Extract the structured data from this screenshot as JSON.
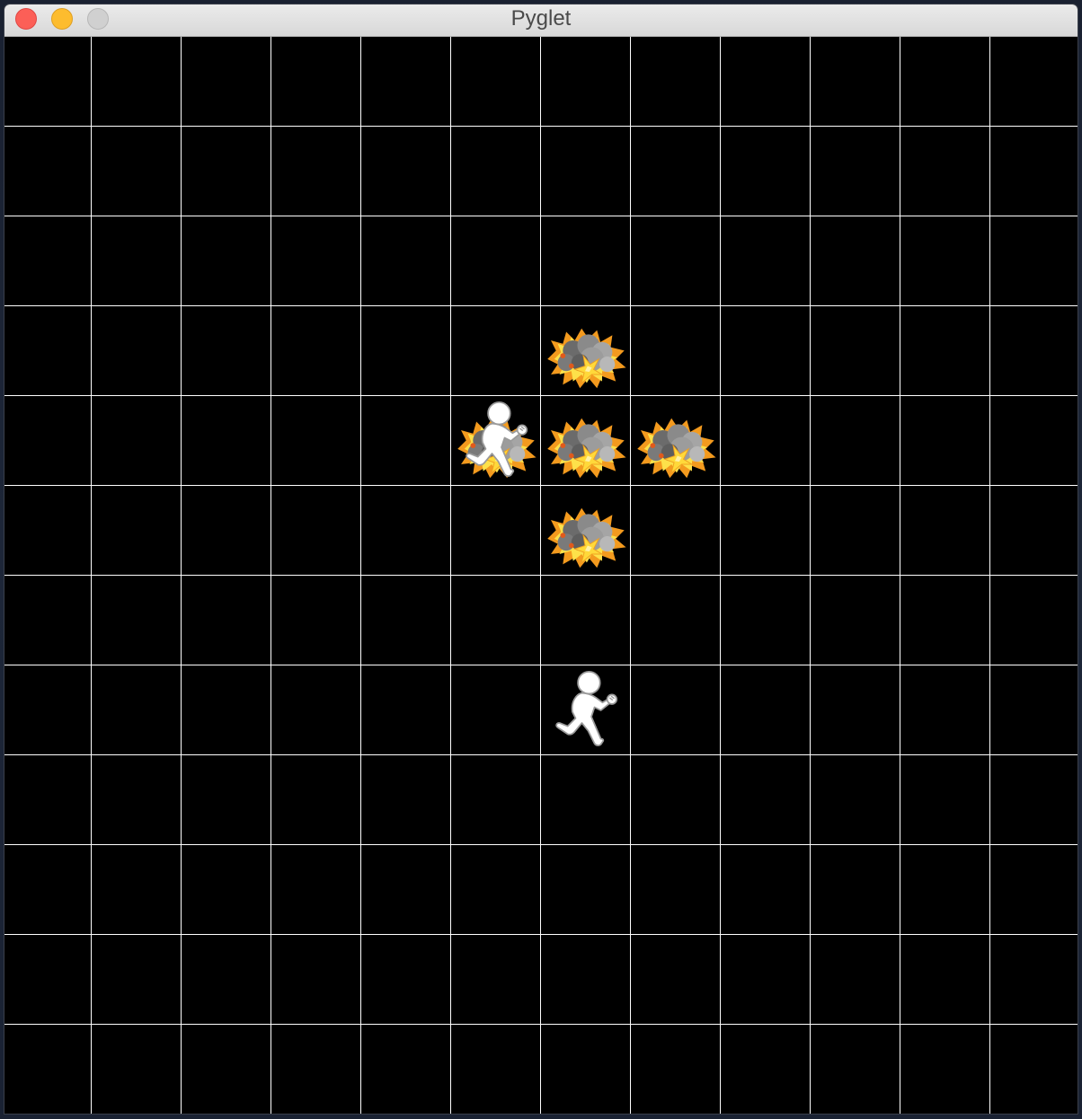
{
  "window": {
    "title": "Pyglet",
    "controls": [
      "close",
      "minimize",
      "zoom"
    ]
  },
  "board": {
    "background_color": "#000000",
    "grid_line_color": "#ffffff",
    "cols": 12,
    "rows": 12,
    "entities": [
      {
        "type": "explosion",
        "icon": "explosion-icon",
        "col": 6,
        "row": 3
      },
      {
        "type": "explosion",
        "icon": "explosion-icon",
        "col": 5,
        "row": 4
      },
      {
        "type": "explosion",
        "icon": "explosion-icon",
        "col": 6,
        "row": 4
      },
      {
        "type": "explosion",
        "icon": "explosion-icon",
        "col": 7,
        "row": 4
      },
      {
        "type": "explosion",
        "icon": "explosion-icon",
        "col": 6,
        "row": 5
      },
      {
        "type": "player",
        "icon": "running-person-icon",
        "col": 5,
        "row": 4
      },
      {
        "type": "player",
        "icon": "running-person-icon",
        "col": 6,
        "row": 7
      }
    ]
  }
}
